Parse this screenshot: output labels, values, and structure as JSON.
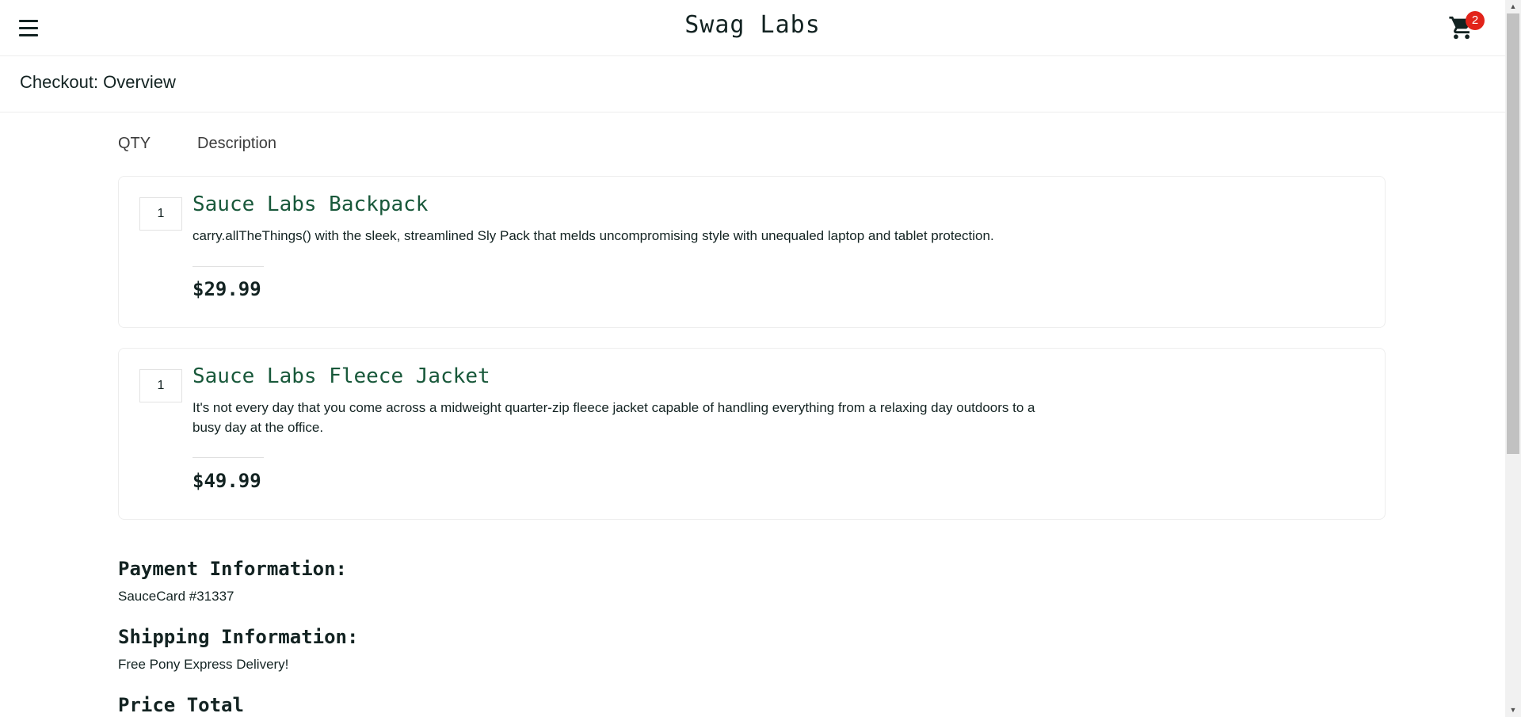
{
  "header": {
    "app_title": "Swag Labs",
    "cart_count": "2",
    "menu_icon": "hamburger-menu-icon",
    "cart_icon": "shopping-cart-icon"
  },
  "page": {
    "title": "Checkout: Overview"
  },
  "columns": {
    "qty": "QTY",
    "description": "Description"
  },
  "items": [
    {
      "qty": "1",
      "name": "Sauce Labs Backpack",
      "description": "carry.allTheThings() with the sleek, streamlined Sly Pack that melds uncompromising style with unequaled laptop and tablet protection.",
      "price": "$29.99"
    },
    {
      "qty": "1",
      "name": "Sauce Labs Fleece Jacket",
      "description": "It's not every day that you come across a midweight quarter-zip fleece jacket capable of handling everything from a relaxing day outdoors to a busy day at the office.",
      "price": "$49.99"
    }
  ],
  "summary": {
    "payment_label": "Payment Information:",
    "payment_value": "SauceCard #31337",
    "shipping_label": "Shipping Information:",
    "shipping_value": "Free Pony Express Delivery!",
    "price_total_label": "Price Total"
  },
  "colors": {
    "item_name": "#18583a",
    "badge": "#e2231a",
    "text": "#132322"
  }
}
